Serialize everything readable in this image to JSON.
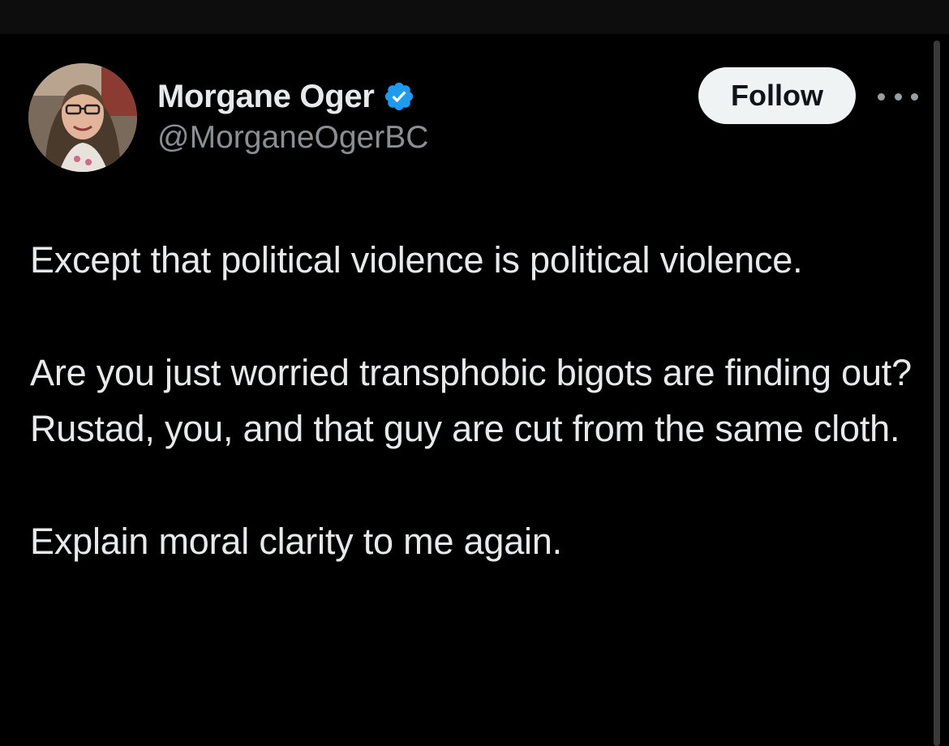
{
  "author": {
    "display_name": "Morgane Oger",
    "handle": "@MorganeOgerBC",
    "verified": true,
    "avatar_icon": "profile-photo"
  },
  "actions": {
    "follow_label": "Follow",
    "more_icon": "more-horizontal-icon"
  },
  "tweet": {
    "paragraphs": [
      "Except that political violence is political violence.",
      "Are you just worried transphobic bigots are finding out? Rustad, you, and that guy are cut from the same cloth.",
      "Explain moral clarity to me again."
    ]
  },
  "colors": {
    "background": "#000000",
    "text_primary": "#e7e9ea",
    "text_secondary": "#8b8f93",
    "verified_badge": "#1d9bf0",
    "follow_button_bg": "#eff3f4",
    "follow_button_text": "#0f1419"
  }
}
